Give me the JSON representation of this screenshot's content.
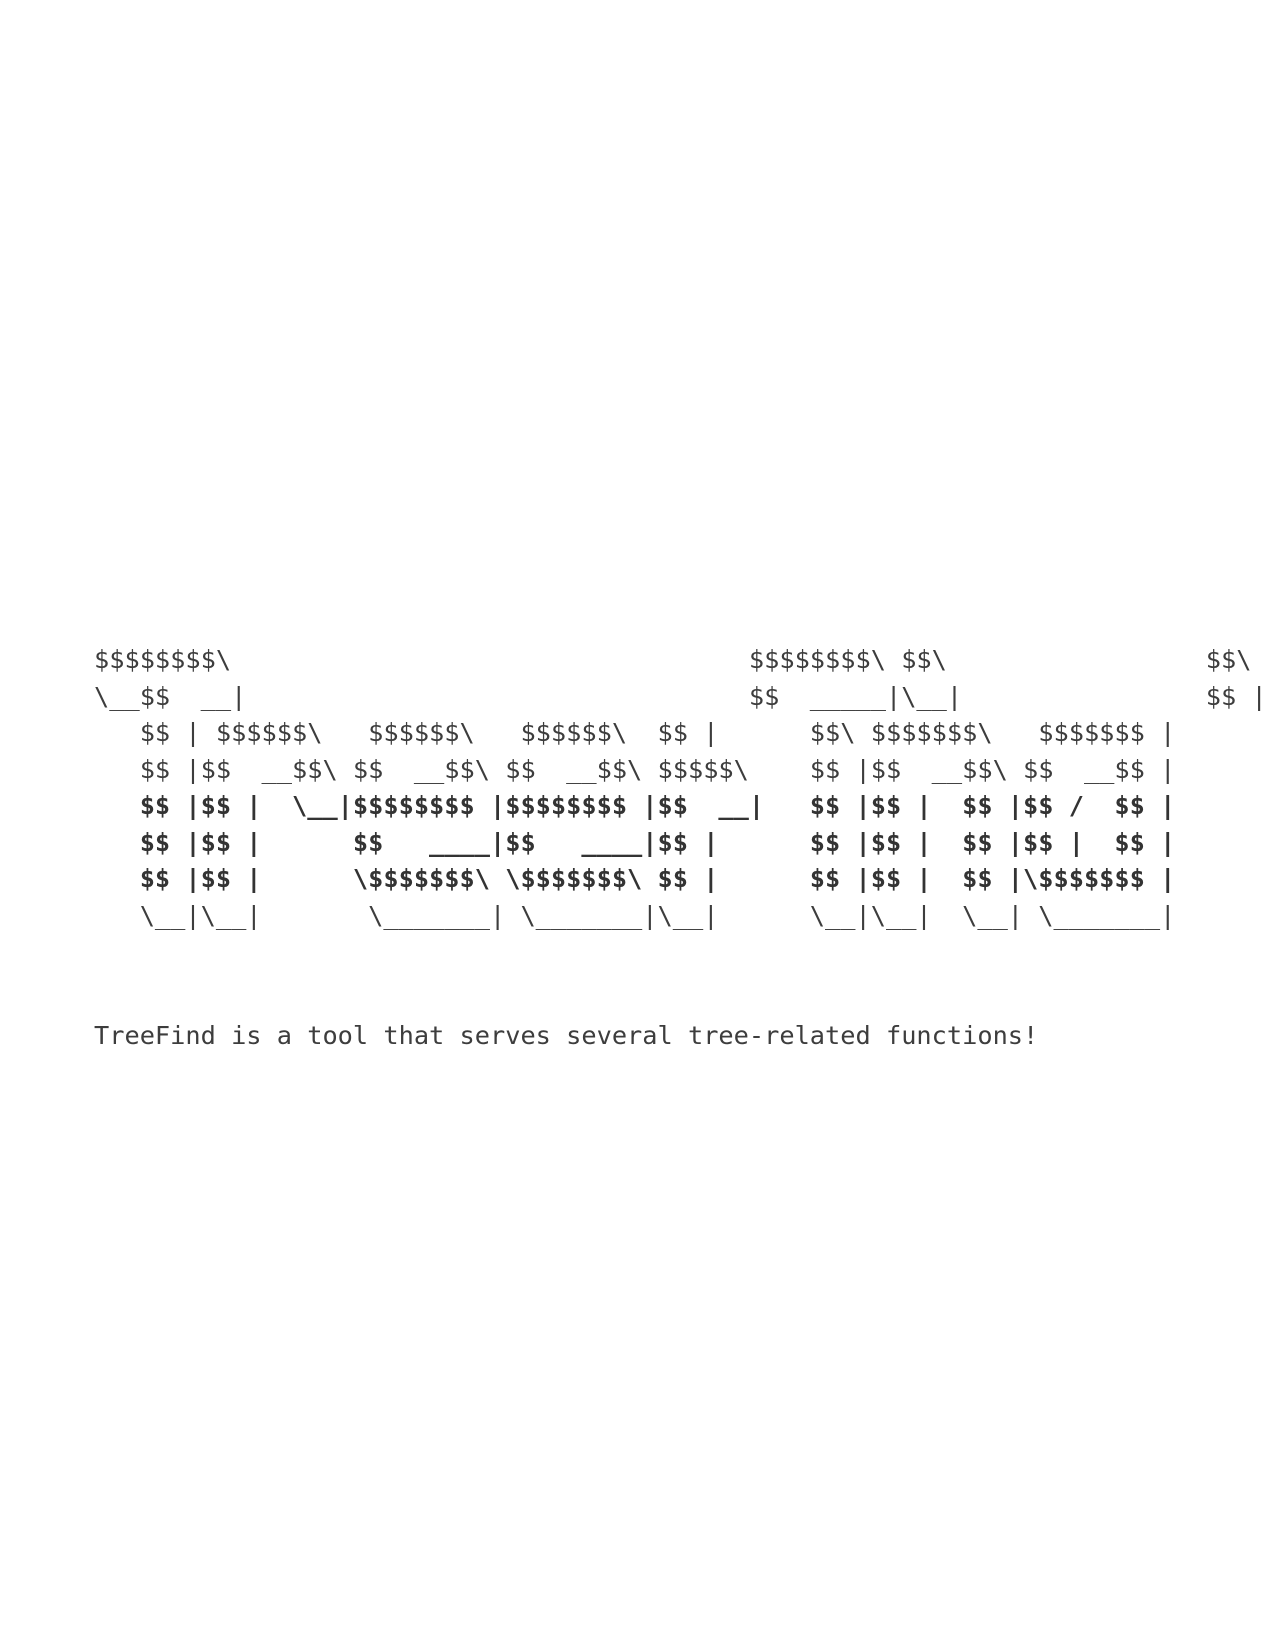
{
  "banner": {
    "lines": [
      "$$$$$$$$\\                                  $$$$$$$$\\ $$\\                 $$\\",
      "\\__$$  __|                                 $$  _____|\\__|                $$ |",
      "   $$ | $$$$$$\\   $$$$$$\\   $$$$$$\\  $$ |      $$\\ $$$$$$$\\   $$$$$$$ |",
      "   $$ |$$  __$$\\ $$  __$$\\ $$  __$$\\ $$$$$\\    $$ |$$  __$$\\ $$  __$$ |",
      "   $$ |$$ |  \\__|$$$$$$$$ |$$$$$$$$ |$$  __|   $$ |$$ |  $$ |$$ /  $$ |",
      "   $$ |$$ |      $$   ____|$$   ____|$$ |      $$ |$$ |  $$ |$$ |  $$ |",
      "   $$ |$$ |      \\$$$$$$$\\ \\$$$$$$$\\ $$ |      $$ |$$ |  $$ |\\$$$$$$$ |",
      "   \\__|\\__|       \\_______| \\_______|\\__|      \\__|\\__|  \\__| \\_______|"
    ]
  },
  "description": "TreeFind is a tool that serves several tree-related functions!"
}
